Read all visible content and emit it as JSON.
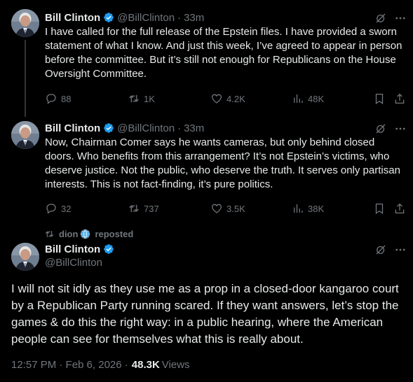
{
  "tweets": [
    {
      "name": "Bill Clinton",
      "handle": "@BillClinton",
      "time": "33m",
      "text": "I have called for the full release of the Epstein files. I have provided a sworn statement of what I know. And just this week, I’ve agreed to appear in person before the committee. But it’s still not enough for Republicans on the House Oversight Committee.",
      "replies": "88",
      "reposts": "1K",
      "likes": "4.2K",
      "views": "48K"
    },
    {
      "name": "Bill Clinton",
      "handle": "@BillClinton",
      "time": "33m",
      "text": "Now, Chairman Comer says he wants cameras, but only behind closed doors. Who benefits from this arrangement? It’s not Epstein’s victims, who deserve justice. Not the public, who deserve the truth. It serves only partisan interests. This is not fact-finding, it’s pure politics.",
      "replies": "32",
      "reposts": "737",
      "likes": "3.5K",
      "views": "38K"
    }
  ],
  "main": {
    "reposted_by": "dion",
    "reposted_label": "reposted",
    "name": "Bill Clinton",
    "handle": "@BillClinton",
    "text": "I will not sit idly as they use me as a prop in a closed-door kangaroo court by a Republican Party running scared. If they want answers, let’s stop the games & do this the right way: in a public hearing, where the American people can see for themselves what this is really about.",
    "timestamp": "12:57 PM · Feb 6, 2026 ·",
    "views_count": "48.3K",
    "views_label": "Views"
  },
  "colors": {
    "background": "#000000",
    "text": "#e7e9ea",
    "muted": "#71767b",
    "verified": "#1d9bf0"
  },
  "icons": [
    "verified-badge-icon",
    "grok-icon",
    "more-icon",
    "reply-icon",
    "repost-icon",
    "like-icon",
    "views-icon",
    "bookmark-icon",
    "share-icon",
    "globe-icon"
  ]
}
